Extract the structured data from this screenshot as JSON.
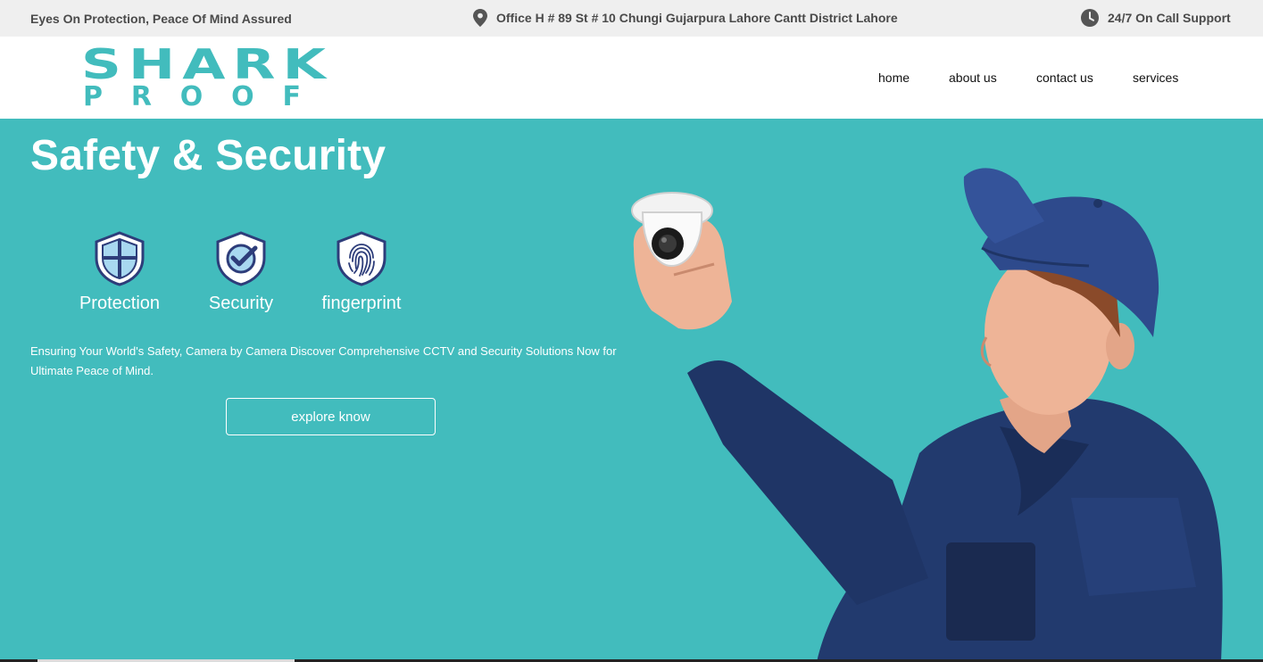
{
  "topbar": {
    "tagline": "Eyes On Protection, Peace Of Mind Assured",
    "address": "Office H # 89 St # 10 Chungi Gujarpura Lahore Cantt District Lahore",
    "support": "24/7 On Call Support",
    "address_icon": "map-pin-icon",
    "support_icon": "clock-icon"
  },
  "brand": {
    "line1": "SHARK",
    "line2": "PROOF",
    "color": "#42bcbd"
  },
  "nav": {
    "items": [
      {
        "label": "home"
      },
      {
        "label": "about us"
      },
      {
        "label": "contact us"
      },
      {
        "label": "services"
      }
    ]
  },
  "hero": {
    "title": "Safety & Security",
    "features": [
      {
        "label": "Protection",
        "icon": "shield-cross-icon"
      },
      {
        "label": "Security",
        "icon": "shield-check-icon"
      },
      {
        "label": "fingerprint",
        "icon": "shield-fingerprint-icon"
      }
    ],
    "description": "Ensuring Your World's Safety, Camera by Camera Discover Comprehensive CCTV and Security Solutions Now for Ultimate Peace of Mind.",
    "cta_label": "explore know",
    "background": "#42bcbd",
    "image_icon": "technician-holding-camera-image"
  }
}
